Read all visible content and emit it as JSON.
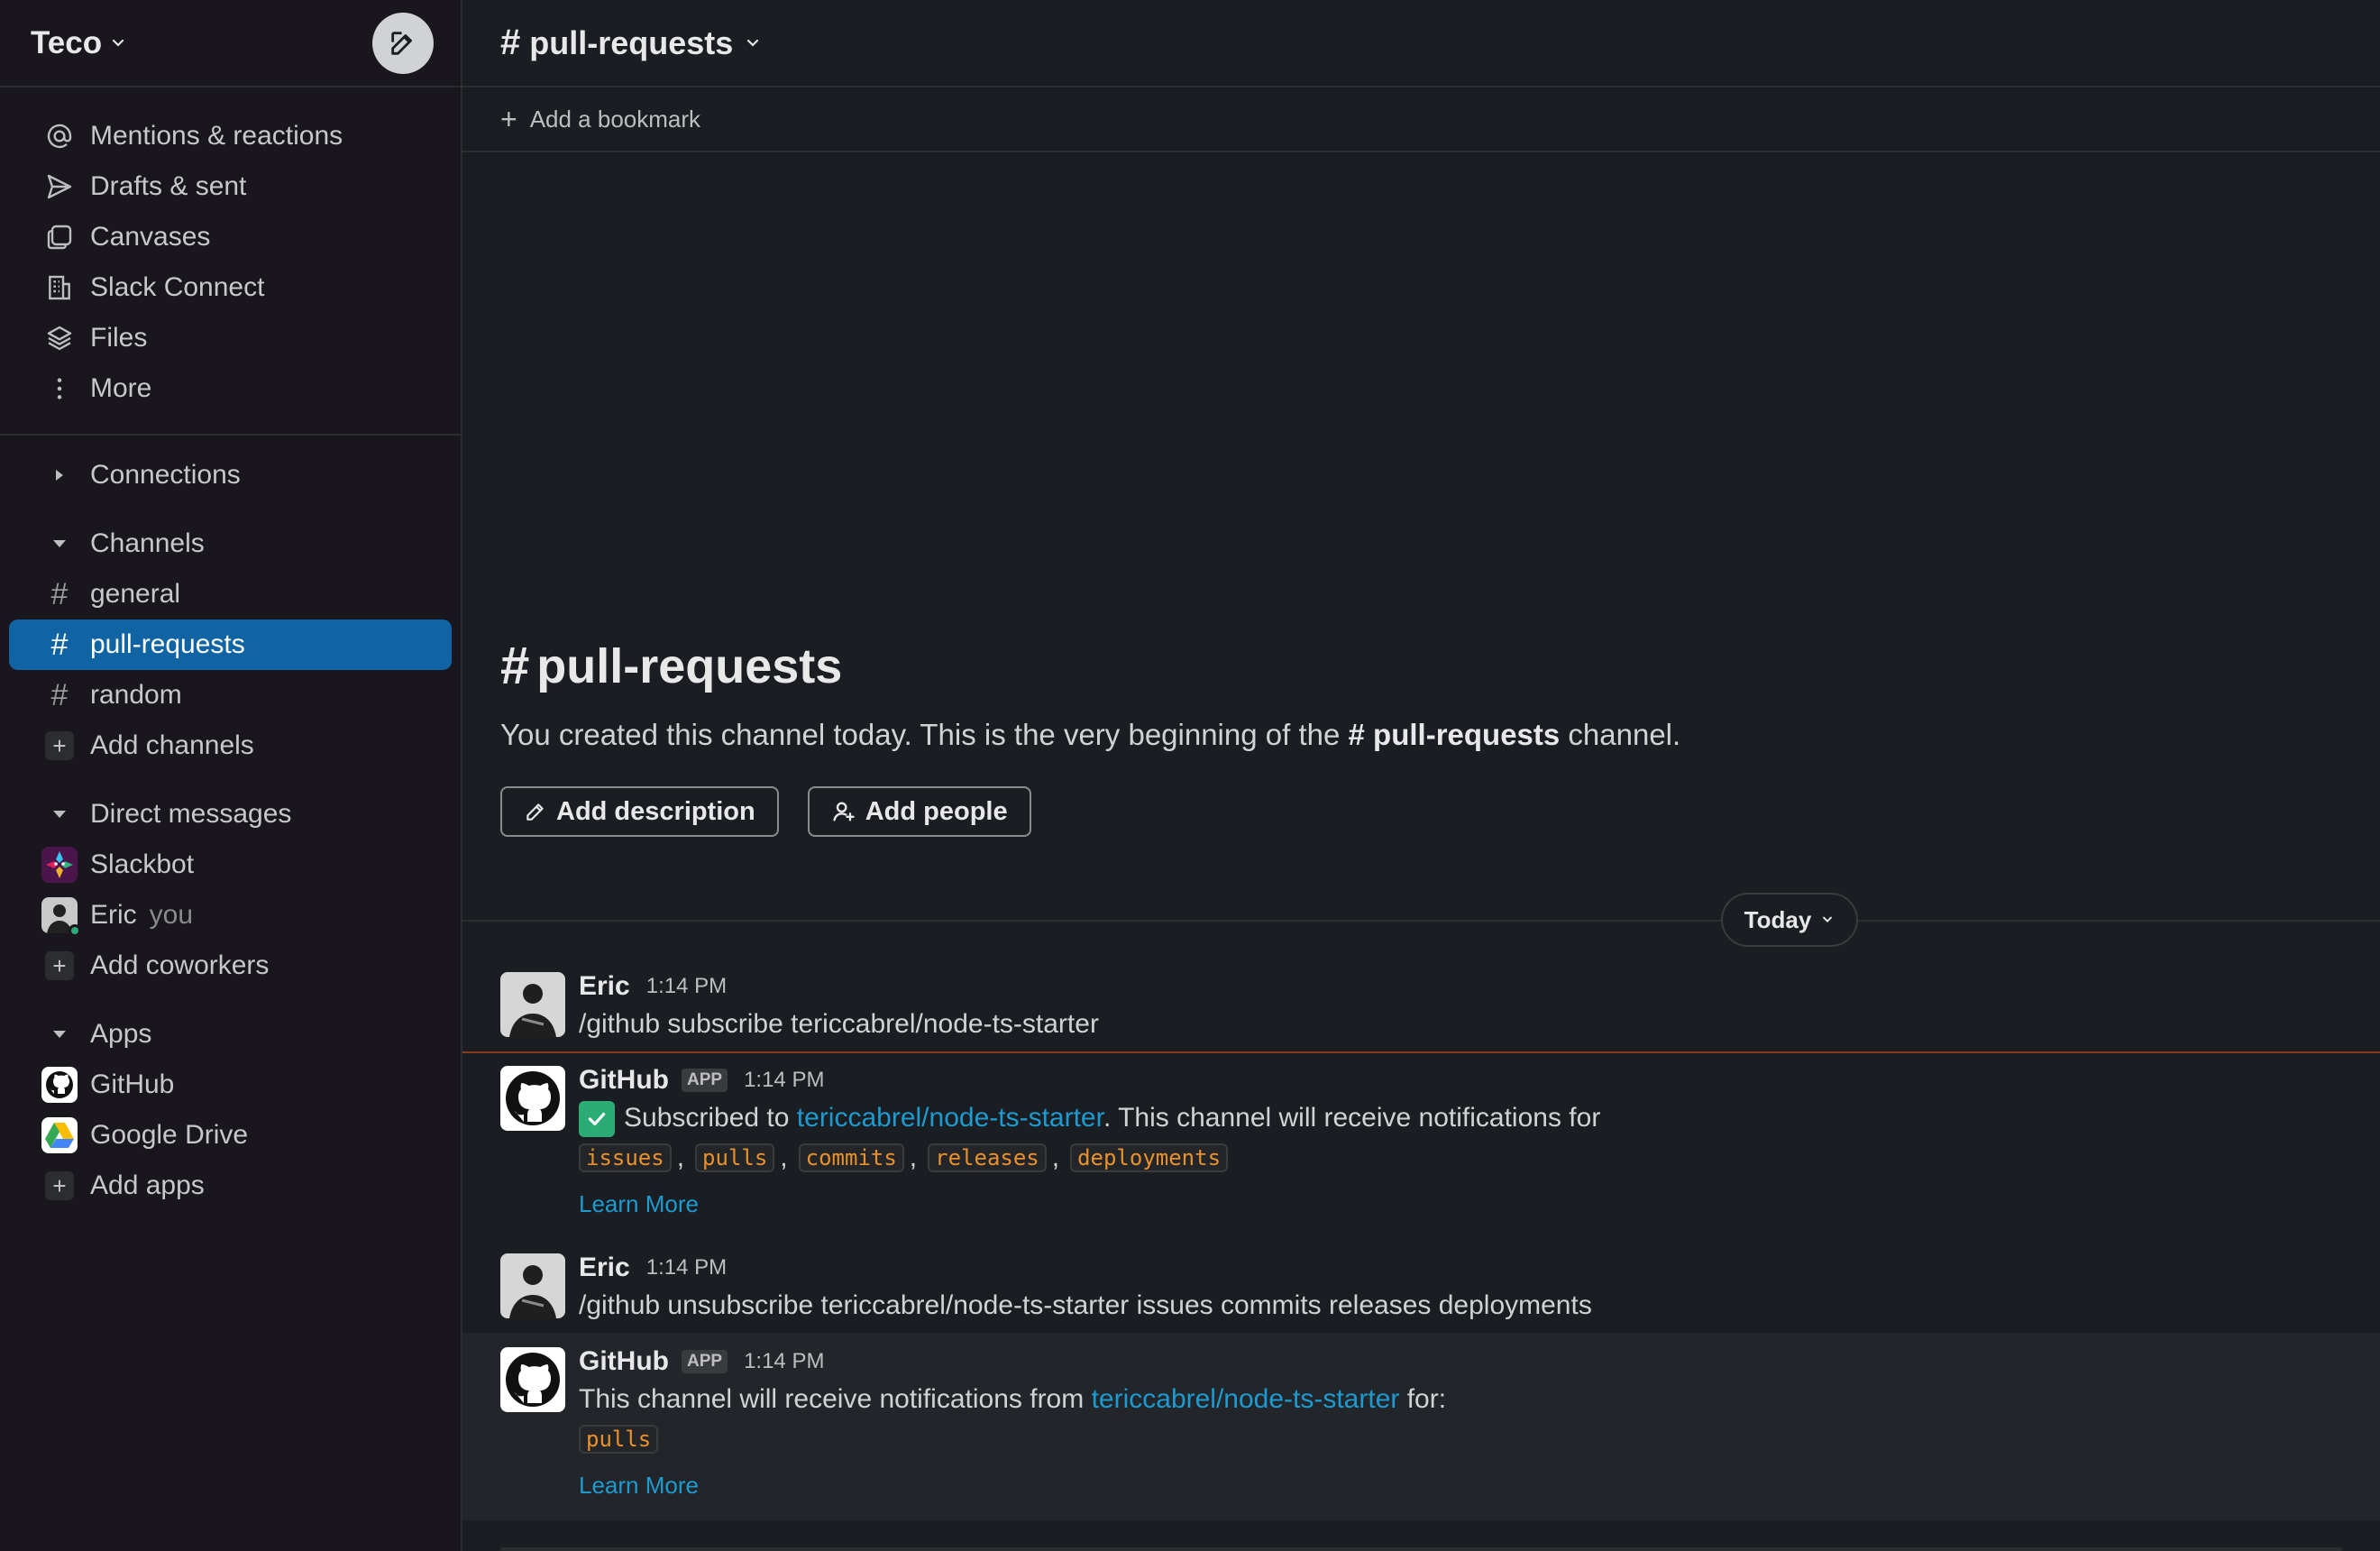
{
  "workspace": {
    "name": "Teco"
  },
  "sidebar": {
    "nav": [
      {
        "label": "Mentions & reactions",
        "icon": "at-icon"
      },
      {
        "label": "Drafts & sent",
        "icon": "send-icon"
      },
      {
        "label": "Canvases",
        "icon": "canvas-icon"
      },
      {
        "label": "Slack Connect",
        "icon": "building-icon"
      },
      {
        "label": "Files",
        "icon": "layers-icon"
      },
      {
        "label": "More",
        "icon": "more-vertical-icon"
      }
    ],
    "connections_label": "Connections",
    "channels_label": "Channels",
    "channels": [
      "general",
      "pull-requests",
      "random"
    ],
    "add_channels": "Add channels",
    "dms_label": "Direct messages",
    "dms": [
      {
        "name": "Slackbot",
        "suffix": ""
      },
      {
        "name": "Eric",
        "suffix": "you"
      }
    ],
    "add_coworkers": "Add coworkers",
    "apps_label": "Apps",
    "apps": [
      "GitHub",
      "Google Drive"
    ],
    "add_apps": "Add apps"
  },
  "channel": {
    "name": "pull-requests",
    "bookmark": "Add a bookmark",
    "intro_before": "You created this channel today. This is the very beginning of the",
    "intro_after": "channel.",
    "add_description": "Add description",
    "add_people": "Add people"
  },
  "divider": {
    "label": "Today"
  },
  "messages": [
    {
      "sender": "Eric",
      "time": "1:14 PM",
      "text": "/github subscribe tericcabrel/node-ts-starter"
    },
    {
      "sender": "GitHub",
      "badge": "APP",
      "time": "1:14 PM",
      "text_before": "Subscribed to",
      "repo": "tericcabrel/node-ts-starter",
      "text_after": ". This channel will receive notifications for",
      "codes": [
        "issues",
        "pulls",
        "commits",
        "releases",
        "deployments"
      ],
      "learn_more": "Learn More"
    },
    {
      "sender": "Eric",
      "time": "1:14 PM",
      "text": "/github unsubscribe tericcabrel/node-ts-starter issues commits releases deployments"
    },
    {
      "sender": "GitHub",
      "badge": "APP",
      "time": "1:14 PM",
      "text_before": "This channel will receive notifications from",
      "repo": "tericcabrel/node-ts-starter",
      "text_after": "for:",
      "codes": [
        "pulls"
      ],
      "learn_more": "Learn More"
    }
  ],
  "colors": {
    "accent": "#1164a3",
    "link": "#1d9bd1",
    "code": "#e8912d",
    "presence": "#2bac76"
  }
}
